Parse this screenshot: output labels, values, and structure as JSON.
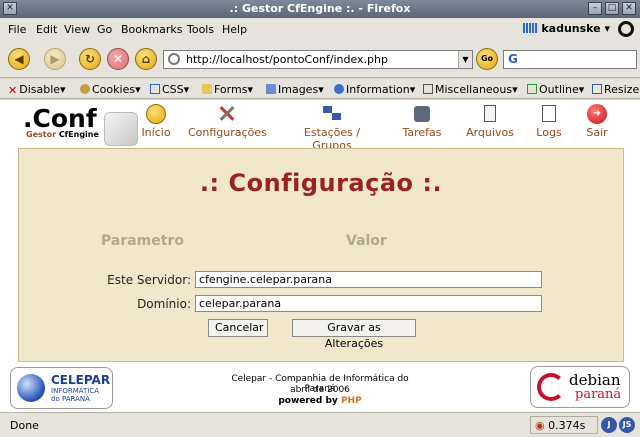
{
  "window": {
    "title": ".: Gestor CfEngine :. - Firefox"
  },
  "menubar": {
    "items": [
      {
        "label": "File"
      },
      {
        "label": "Edit"
      },
      {
        "label": "View"
      },
      {
        "label": "Go"
      },
      {
        "label": "Bookmarks"
      },
      {
        "label": "Tools"
      },
      {
        "label": "Help"
      }
    ],
    "user": "kadunske"
  },
  "navigation": {
    "url": "http://localhost/pontoConf/index.php",
    "go_label": "Go",
    "search_value": "G"
  },
  "devtoolbar": {
    "items": [
      {
        "label": "Disable",
        "icon": "red-x-icon"
      },
      {
        "label": "Cookies",
        "icon": "cookie-icon"
      },
      {
        "label": "CSS",
        "icon": "css-icon"
      },
      {
        "label": "Forms",
        "icon": "forms-icon"
      },
      {
        "label": "Images",
        "icon": "images-icon"
      },
      {
        "label": "Information",
        "icon": "info-icon"
      },
      {
        "label": "Miscellaneous",
        "icon": "misc-icon"
      },
      {
        "label": "Outline",
        "icon": "outline-icon"
      },
      {
        "label": "Resize",
        "icon": "resize-icon"
      }
    ]
  },
  "app": {
    "logo": ".Conf",
    "logo_sub_prefix": "Gestor ",
    "logo_sub_bold": "CfEngine",
    "nav": [
      {
        "label": "Início",
        "icon": "home-icon"
      },
      {
        "label": "Configurações",
        "icon": "tools-icon"
      },
      {
        "label": "Estações / Grupos",
        "icon": "workstations-icon"
      },
      {
        "label": "Tarefas",
        "icon": "tasks-icon"
      },
      {
        "label": "Arquivos",
        "icon": "files-icon"
      },
      {
        "label": "Logs",
        "icon": "logs-icon"
      },
      {
        "label": "Sair",
        "icon": "exit-icon"
      }
    ]
  },
  "page": {
    "heading": ".: Configuração :.",
    "col_param": "Parametro",
    "col_value": "Valor",
    "fields": [
      {
        "label": "Este Servidor:",
        "value": "cfengine.celepar.parana"
      },
      {
        "label": "Domínio:",
        "value": "celepar.parana"
      }
    ],
    "cancel_label": "Cancelar",
    "save_label": "Gravar as Alterações"
  },
  "footer": {
    "celepar_name": "CELEPAR",
    "celepar_line1": "INFORMÁTICA",
    "celepar_line2": "do PARANÁ",
    "line1": "Celepar - Companhia de Informática do Paraná",
    "line2": "abril de  2006",
    "powered_prefix": "powered by ",
    "powered_php": "PHP",
    "debian_text": "debian",
    "parana_text": "paraná"
  },
  "status": {
    "text": "Done",
    "time": "0.374s",
    "j_label": "J",
    "js_label": "JS"
  }
}
